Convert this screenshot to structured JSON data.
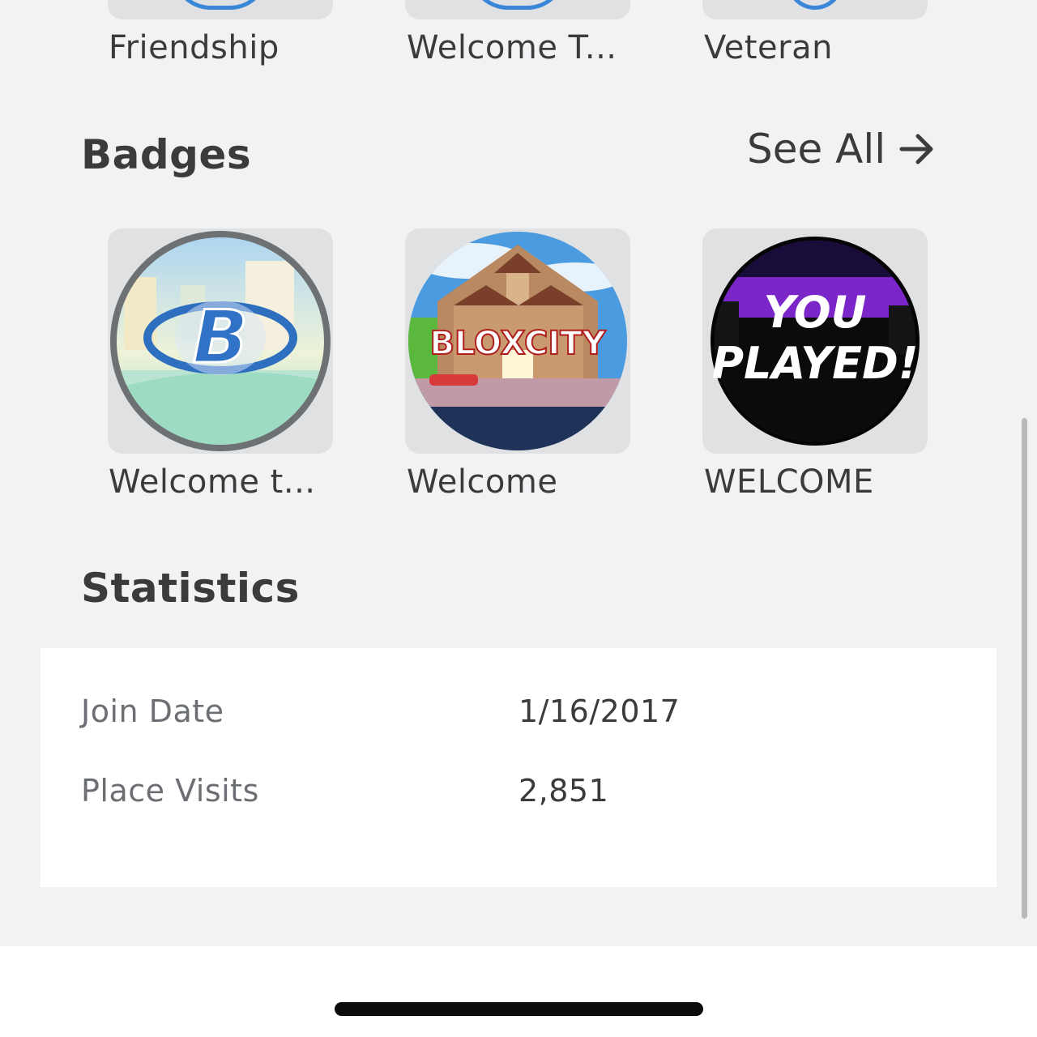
{
  "top_row": {
    "items": [
      {
        "label": "Friendship"
      },
      {
        "label": "Welcome T..."
      },
      {
        "label": "Veteran"
      }
    ]
  },
  "badges": {
    "title": "Badges",
    "see_all_label": "See All",
    "items": [
      {
        "label": "Welcome t...",
        "icon": "letter-b-emblem-icon",
        "art_text": "B"
      },
      {
        "label": "Welcome",
        "icon": "bloxcity-mansion-icon",
        "art_text": "BLOXCITY"
      },
      {
        "label": "WELCOME",
        "icon": "you-played-icon",
        "art_text": [
          "YOU",
          "PLAYED!"
        ]
      }
    ]
  },
  "statistics": {
    "title": "Statistics",
    "rows": [
      {
        "label": "Join Date",
        "value": "1/16/2017"
      },
      {
        "label": "Place Visits",
        "value": "2,851"
      }
    ]
  },
  "colors": {
    "page_background": "#f1f2f4",
    "tile_background": "#e0e1e3",
    "text_primary": "#393b3d",
    "text_secondary": "#6b6e72"
  }
}
